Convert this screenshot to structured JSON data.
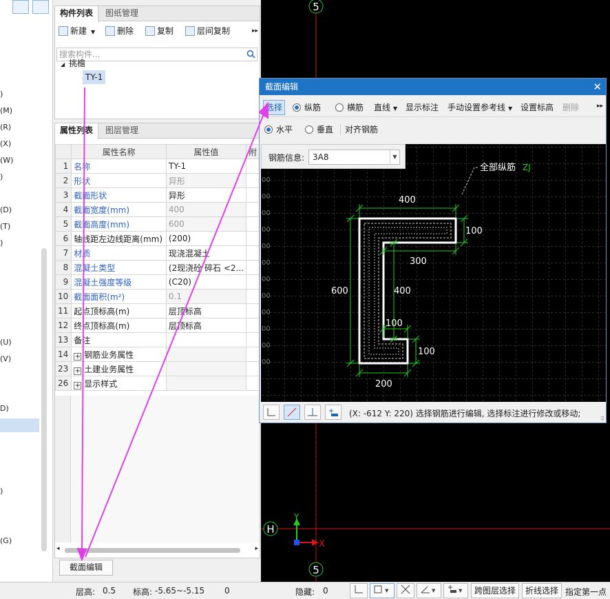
{
  "left_strip": {
    "items": [
      "(M)",
      "(R)",
      "(X)",
      "(W)",
      ")",
      "(D)",
      "(T)",
      ")",
      "(U)",
      "(V)",
      "D)",
      ")",
      "(G)"
    ]
  },
  "component_panel": {
    "tabs": [
      "构件列表",
      "图纸管理"
    ],
    "toolbar": {
      "new": "新建",
      "delete": "删除",
      "copy": "复制",
      "floor_copy": "层间复制"
    },
    "search_placeholder": "搜索构件...",
    "tree": {
      "group": "挑檐",
      "item": "TY-1"
    }
  },
  "property_panel": {
    "tabs": [
      "属性列表",
      "图层管理"
    ],
    "headers": {
      "name": "属性名称",
      "value": "属性值",
      "extra": "附"
    },
    "rows": [
      {
        "num": "1",
        "name": "名称",
        "value": "TY-1",
        "name_style": "blue",
        "value_style": ""
      },
      {
        "num": "2",
        "name": "形状",
        "value": "异形",
        "name_style": "blue",
        "value_style": "grey"
      },
      {
        "num": "3",
        "name": "截面形状",
        "value": "异形",
        "name_style": "blue",
        "value_style": ""
      },
      {
        "num": "4",
        "name": "截面宽度(mm)",
        "value": "400",
        "name_style": "blue",
        "value_style": "grey"
      },
      {
        "num": "5",
        "name": "截面高度(mm)",
        "value": "600",
        "name_style": "blue",
        "value_style": "grey"
      },
      {
        "num": "6",
        "name": "轴线距左边线距离(mm)",
        "value": "(200)",
        "name_style": "",
        "value_style": ""
      },
      {
        "num": "7",
        "name": "材质",
        "value": "现浇混凝土",
        "name_style": "blue",
        "value_style": ""
      },
      {
        "num": "8",
        "name": "混凝土类型",
        "value": "(2现浇砼 碎石 <2...",
        "name_style": "blue",
        "value_style": ""
      },
      {
        "num": "9",
        "name": "混凝土强度等级",
        "value": "(C20)",
        "name_style": "blue",
        "value_style": ""
      },
      {
        "num": "10",
        "name": "截面面积(m²)",
        "value": "0.1",
        "name_style": "blue",
        "value_style": "grey"
      },
      {
        "num": "11",
        "name": "起点顶标高(m)",
        "value": "层顶标高",
        "name_style": "",
        "value_style": ""
      },
      {
        "num": "12",
        "name": "终点顶标高(m)",
        "value": "层顶标高",
        "name_style": "",
        "value_style": ""
      },
      {
        "num": "13",
        "name": "备注",
        "value": "",
        "name_style": "",
        "value_style": ""
      },
      {
        "num": "14",
        "name": "钢筋业务属性",
        "value": "",
        "name_style": "group",
        "value_style": ""
      },
      {
        "num": "23",
        "name": "土建业务属性",
        "value": "",
        "name_style": "group",
        "value_style": ""
      },
      {
        "num": "26",
        "name": "显示样式",
        "value": "",
        "name_style": "group",
        "value_style": ""
      }
    ],
    "section_edit_button": "截面编辑"
  },
  "dialog": {
    "title": "截面编辑",
    "toolbar1": {
      "select": "选择",
      "longitudinal": "纵筋",
      "transverse": "横筋",
      "line": "直线",
      "show_label": "显示标注",
      "manual_ref": "手动设置参考线",
      "set_elev": "设置标高",
      "delete": "删除"
    },
    "toolbar2": {
      "horizontal": "水平",
      "vertical": "垂直",
      "align": "对齐钢筋"
    },
    "rebar_info_label": "钢筋信息:",
    "rebar_info_value": "3A8",
    "drawing": {
      "callout_label": "全部纵筋",
      "callout_code": "ZJ",
      "dims": [
        "400",
        "100",
        "300",
        "600",
        "400",
        "100",
        "100",
        "200"
      ],
      "grid_label": "00"
    },
    "status_text": "(X: -612 Y: 220)  选择钢筋进行编辑, 选择标注进行修改或移动;"
  },
  "cad": {
    "axis_top": "5",
    "axis_bottom": "5",
    "axis_h": "H",
    "ucs_x": "X",
    "ucs_y": "Y"
  },
  "statusbar": {
    "floor_height_label": "层高:",
    "floor_height": "0.5",
    "elev_label": "标高:",
    "elev": "-5.65~-5.15",
    "zero": "0",
    "hidden_label": "隐藏:",
    "hidden": "0",
    "cross_layer": "跨图层选择",
    "polyline": "折线选择",
    "assign_first": "指定第一点"
  },
  "colors": {
    "accent": "#1e73c4",
    "link_blue": "#2f62c7",
    "annotation_magenta": "#e040e8",
    "dim_green": "#22cc22",
    "axis_red": "#d01818"
  }
}
